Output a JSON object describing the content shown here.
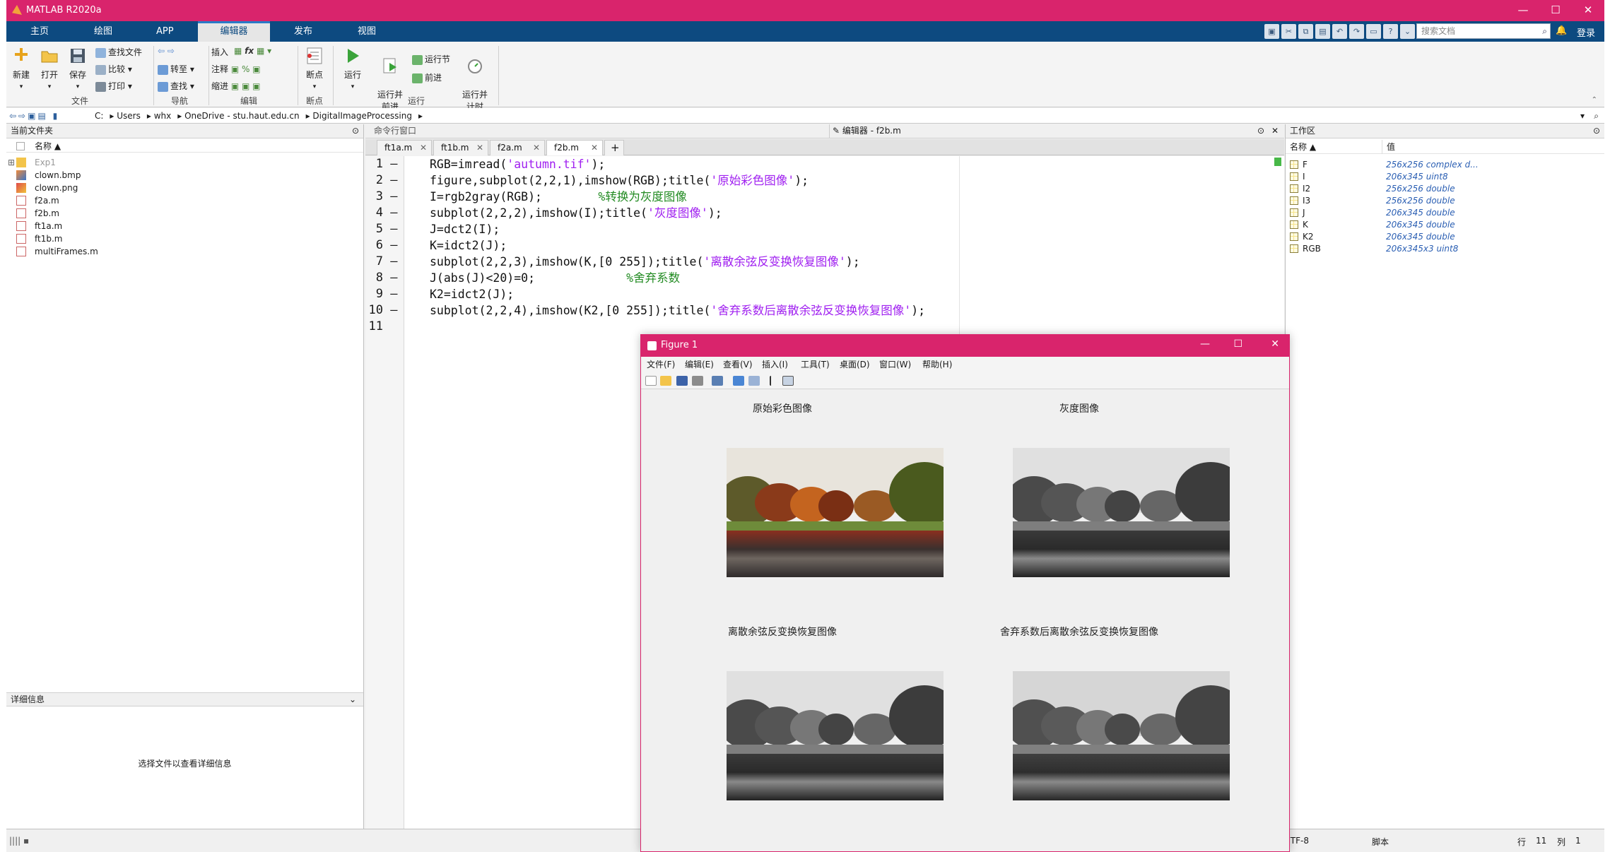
{
  "app": {
    "title": "MATLAB R2020a",
    "win_min": "—",
    "win_max": "☐",
    "win_close": "✕"
  },
  "tabs": [
    "主页",
    "绘图",
    "APP",
    "编辑器",
    "发布",
    "视图"
  ],
  "search": {
    "placeholder": "搜索文档"
  },
  "login": "登录",
  "ribbon": {
    "new": "新建",
    "open": "打开",
    "save": "保存",
    "find_files": "查找文件",
    "compare": "比较",
    "print": "打印",
    "goto": "转至",
    "find": "查找",
    "insert": "插入",
    "fx": "fx",
    "comment": "注释",
    "indent": "缩进",
    "breakpoints": "断点",
    "run": "运行",
    "run_advance": "运行并\n前进",
    "run_section": "运行节",
    "advance": "前进",
    "run_time": "运行并\n计时",
    "groups": {
      "file": "文件",
      "nav": "导航",
      "edit": "编辑",
      "bp": "断点",
      "run": "运行"
    }
  },
  "address": [
    "C:",
    "Users",
    "whx",
    "OneDrive - stu.haut.edu.cn",
    "DigitalImageProcessing"
  ],
  "current_folder": {
    "title": "当前文件夹",
    "col_name": "名称 ▲",
    "items": [
      "Exp1",
      "clown.bmp",
      "clown.png",
      "f2a.m",
      "f2b.m",
      "ft1a.m",
      "ft1b.m",
      "multiFrames.m"
    ]
  },
  "details": {
    "title": "详细信息",
    "hint": "选择文件以查看详细信息"
  },
  "command_window": {
    "title": "命令行窗口"
  },
  "editor": {
    "title": "编辑器 - f2b.m",
    "tabs": [
      "ft1a.m",
      "ft1b.m",
      "f2a.m",
      "f2b.m"
    ],
    "add_tab": "+",
    "line_numbers": [
      "1",
      "2",
      "3",
      "4",
      "5",
      "6",
      "7",
      "8",
      "9",
      "10",
      "11"
    ]
  },
  "workspace": {
    "title": "工作区",
    "col_name": "名称 ▲",
    "col_value": "值",
    "vars": [
      {
        "name": "F",
        "value": "256x256 complex d..."
      },
      {
        "name": "I",
        "value": "206x345 uint8"
      },
      {
        "name": "I2",
        "value": "256x256 double"
      },
      {
        "name": "I3",
        "value": "256x256 double"
      },
      {
        "name": "J",
        "value": "206x345 double"
      },
      {
        "name": "K",
        "value": "206x345 double"
      },
      {
        "name": "K2",
        "value": "206x345 double"
      },
      {
        "name": "RGB",
        "value": "206x345x3 uint8"
      }
    ]
  },
  "figure": {
    "title": "Figure 1",
    "menu": [
      "文件(F)",
      "编辑(E)",
      "查看(V)",
      "插入(I)",
      "工具(T)",
      "桌面(D)",
      "窗口(W)",
      "帮助(H)"
    ],
    "subplots": [
      "原始彩色图像",
      "灰度图像",
      "离散余弦反变换恢复图像",
      "舍弃系数后离散余弦反变换恢复图像"
    ]
  },
  "status": {
    "encoding": "UTF-8",
    "type": "脚本",
    "row_label": "行",
    "row": "11",
    "col_label": "列",
    "col": "1"
  }
}
